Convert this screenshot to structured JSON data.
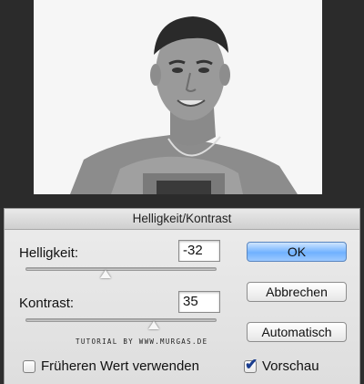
{
  "dialog": {
    "title": "Helligkeit/Kontrast",
    "brightness": {
      "label": "Helligkeit:",
      "value": "-32",
      "slider_fraction": 0.42
    },
    "contrast": {
      "label": "Kontrast:",
      "value": "35",
      "slider_fraction": 0.67
    },
    "buttons": {
      "ok": "OK",
      "cancel": "Abbrechen",
      "auto": "Automatisch"
    },
    "watermark": "TUTORIAL BY WWW.MURGAS.DE",
    "use_previous": {
      "label": "Früheren Wert verwenden",
      "checked": false
    },
    "preview": {
      "label": "Vorschau",
      "checked": true
    },
    "accent": "#6fb1ff"
  }
}
